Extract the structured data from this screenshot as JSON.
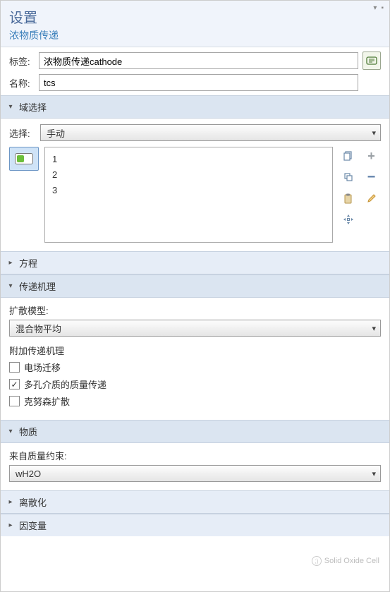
{
  "header": {
    "title": "设置",
    "subtitle": "浓物质传递"
  },
  "fields": {
    "tag_label": "标签:",
    "tag_value": "浓物质传递cathode",
    "name_label": "名称:",
    "name_value": "tcs"
  },
  "sections": {
    "domain_selection": "域选择",
    "equation": "方程",
    "transport_mechanisms": "传递机理",
    "species": "物质",
    "discretization": "离散化",
    "dependent_variables": "因变量"
  },
  "domain": {
    "select_label": "选择:",
    "select_value": "手动",
    "items": [
      "1",
      "2",
      "3"
    ]
  },
  "transport": {
    "diffusion_model_label": "扩散模型:",
    "diffusion_model_value": "混合物平均",
    "additional_label": "附加传递机理",
    "opt1": "电场迁移",
    "opt2": "多孔介质的质量传递",
    "opt3": "克努森扩散"
  },
  "species": {
    "from_mass_label": "来自质量约束:",
    "value": "wH2O"
  },
  "branding": "Solid Oxide Cell"
}
